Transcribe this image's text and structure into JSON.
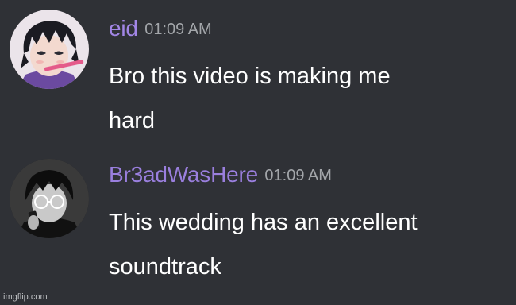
{
  "messages": [
    {
      "username": "eid",
      "timestamp": "01:09 AM",
      "lines": [
        "Bro this video is making me",
        "hard"
      ],
      "avatar_icon": "anime-boy-avatar",
      "username_color": "#a286e6"
    },
    {
      "username": "Br3adWasHere",
      "timestamp": "01:09 AM",
      "lines": [
        "This wedding has an excellent",
        "soundtrack"
      ],
      "avatar_icon": "monochrome-anime-avatar",
      "username_color": "#9a7fde"
    }
  ],
  "watermark": "imgflip.com",
  "colors": {
    "background": "#2f3136",
    "message_text": "#ffffff",
    "timestamp": "#a3a6aa"
  }
}
